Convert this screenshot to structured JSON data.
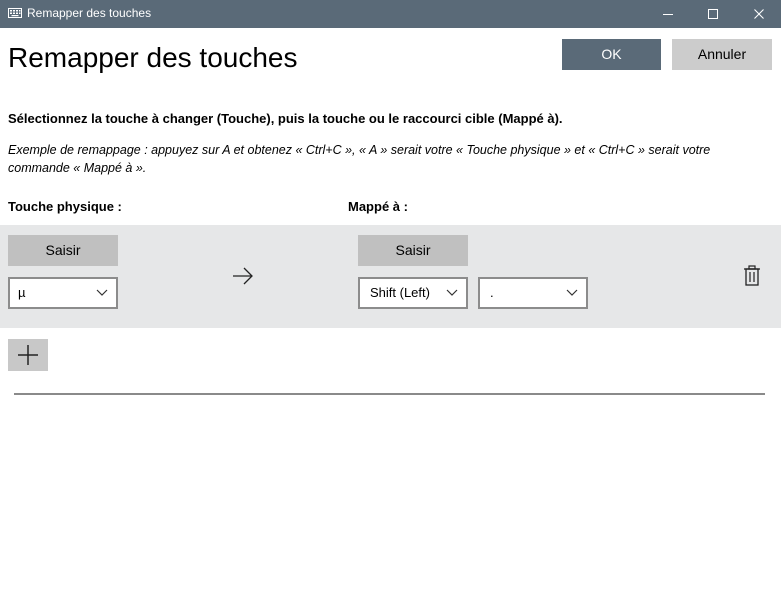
{
  "window": {
    "title": "Remapper des touches",
    "controls": [
      "minimize",
      "maximize",
      "close"
    ]
  },
  "header": {
    "title": "Remapper des touches",
    "ok_label": "OK",
    "cancel_label": "Annuler"
  },
  "instructions": "Sélectionnez la touche à changer (Touche), puis la touche ou le raccourci cible (Mappé à).",
  "example": "Exemple de remappage : appuyez sur A et obtenez « Ctrl+C », « A » serait votre « Touche physique » et « Ctrl+C » serait votre commande « Mappé à ».",
  "columns": {
    "physical": "Touche physique :",
    "mapped": "Mappé à :"
  },
  "rows": [
    {
      "capture_label": "Saisir",
      "physical_key": "µ",
      "mapped_capture_label": "Saisir",
      "mapped_modifier": "Shift (Left)",
      "mapped_key": "."
    }
  ],
  "icons": {
    "app": "keyboard-icon",
    "arrow": "arrow-right-icon",
    "delete": "trash-icon",
    "add": "plus-icon",
    "dropdown": "chevron-down-icon"
  },
  "colors": {
    "titlebar": "#5a6a78",
    "accent_button": "#5a6a78",
    "secondary_button": "#cccccc",
    "row_background": "#e6e7e8",
    "capture_button": "#c0c0c0"
  }
}
